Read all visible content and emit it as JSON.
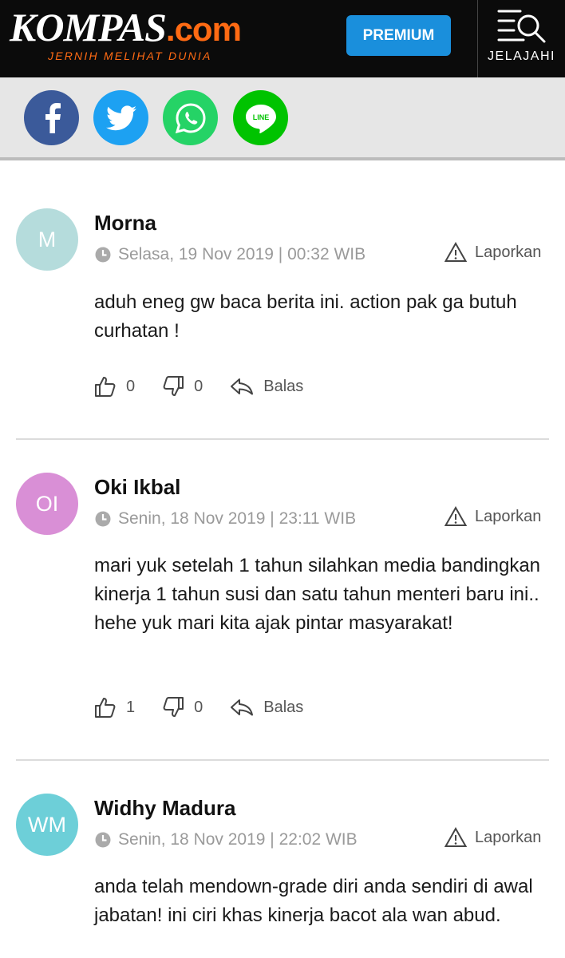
{
  "header": {
    "logo_main": "KOMPAS",
    "logo_suffix": ".com",
    "tagline": "JERNIH MELIHAT DUNIA",
    "premium_label": "PREMIUM",
    "explore_label": "JELAJAHI"
  },
  "share": [
    {
      "name": "facebook",
      "icon": "facebook-icon",
      "color": "#3b5a9a"
    },
    {
      "name": "twitter",
      "icon": "twitter-icon",
      "color": "#1da1f2"
    },
    {
      "name": "whatsapp",
      "icon": "whatsapp-icon",
      "color": "#25d366"
    },
    {
      "name": "line",
      "icon": "line-icon",
      "label": "LINE",
      "color": "#00c300"
    }
  ],
  "comments": [
    {
      "initials": "M",
      "avatar_color": "#b5dcdc",
      "name": "Morna",
      "date": "Selasa, 19 Nov 2019 | 00:32 WIB",
      "report_label": "Laporkan",
      "text": "aduh eneg gw baca berita ini. action pak ga butuh curhatan !",
      "likes": "0",
      "dislikes": "0",
      "reply_label": "Balas"
    },
    {
      "initials": "OI",
      "avatar_color": "#d98fd6",
      "name": "Oki Ikbal",
      "date": "Senin, 18 Nov 2019 | 23:11 WIB",
      "report_label": "Laporkan",
      "text": "mari yuk setelah 1 tahun silahkan media bandingkan kinerja 1 tahun susi dan satu tahun menteri baru ini.. hehe yuk mari kita ajak pintar masyarakat!",
      "likes": "1",
      "dislikes": "0",
      "reply_label": "Balas"
    },
    {
      "initials": "WM",
      "avatar_color": "#6dcfd8",
      "name": "Widhy Madura",
      "date": "Senin, 18 Nov 2019 | 22:02 WIB",
      "report_label": "Laporkan",
      "text": "anda telah mendown-grade diri anda sendiri di awal jabatan! ini ciri khas kinerja bacot ala wan abud.",
      "likes": "",
      "dislikes": "",
      "reply_label": ""
    }
  ]
}
